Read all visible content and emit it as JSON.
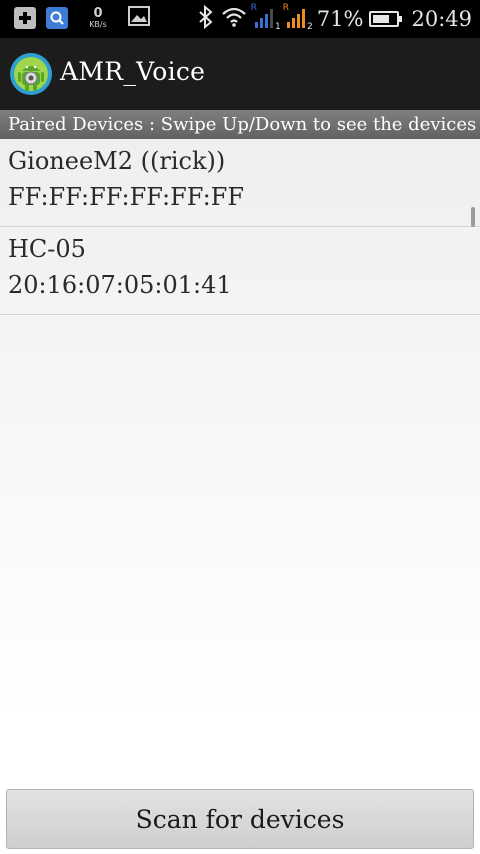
{
  "status_bar": {
    "speed_value": "0",
    "speed_unit": "KB/s",
    "sim1_roaming": "R",
    "sim1_slot": "1",
    "sim2_roaming": "R",
    "sim2_slot": "2",
    "battery_percent": "71%",
    "battery_level": 0.71,
    "time": "20:49",
    "icons": [
      "add-icon",
      "search-icon",
      "image-icon",
      "bluetooth-icon",
      "wifi-icon",
      "signal-icon",
      "battery-icon"
    ]
  },
  "action_bar": {
    "title": "AMR_Voice",
    "icon": "android-app-icon"
  },
  "paired_header": "Paired Devices : Swipe Up/Down to see the devices",
  "devices": [
    {
      "name": "GioneeM2 ((rick))",
      "address": "FF:FF:FF:FF:FF:FF"
    },
    {
      "name": "HC-05",
      "address": "20:16:07:05:01:41"
    }
  ],
  "scan_button_label": "Scan for devices",
  "colors": {
    "status_bar_bg": "#000000",
    "action_bar_bg": "#1c1c1c",
    "header_bg": "#6f6f6f",
    "signal_sim1": "#3b6fd8",
    "signal_sim2": "#f08a24"
  }
}
